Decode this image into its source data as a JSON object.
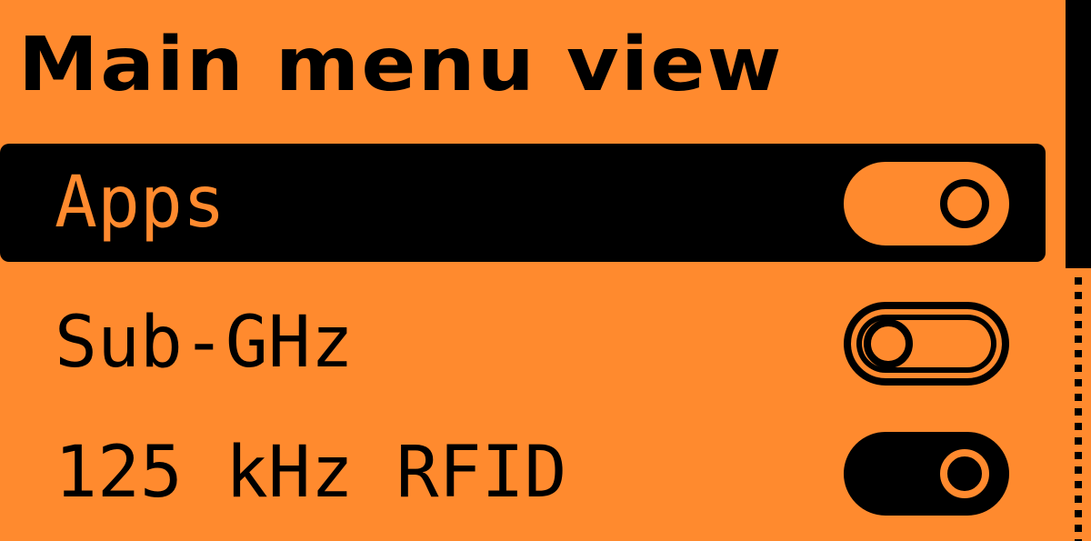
{
  "header": {
    "title": "Main menu view"
  },
  "menu": {
    "items": [
      {
        "label": "Apps",
        "toggle": "on",
        "selected": true
      },
      {
        "label": "Sub-GHz",
        "toggle": "off",
        "selected": false
      },
      {
        "label": "125 kHz RFID",
        "toggle": "on",
        "selected": false
      }
    ]
  },
  "colors": {
    "background": "#FF8A2E",
    "foreground": "#000000"
  },
  "icons": {
    "toggle_on": "toggle-on-icon",
    "toggle_off": "toggle-off-icon"
  }
}
